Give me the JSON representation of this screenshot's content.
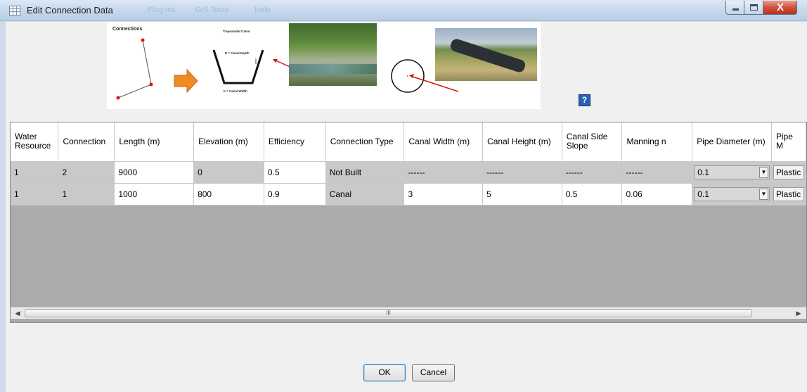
{
  "window": {
    "title": "Edit Connection Data",
    "background_menu": [
      "Plug-ins",
      "GIS Tools",
      "Help"
    ],
    "close_glyph": "X"
  },
  "banner": {
    "connections_label": "Connections",
    "trapezoid_title": "Trapezoidal Canal",
    "depth_label": "D = Canal Depth",
    "width_label": "b = Canal Width",
    "arrow_color": "#f08a24"
  },
  "help_label": "?",
  "grid": {
    "columns": [
      "Water Resource",
      "Connection",
      "Length (m)",
      "Elevation (m)",
      "Efficiency",
      "Connection Type",
      "Canal Width (m)",
      "Canal Height (m)",
      "Canal Side Slope",
      "Manning n",
      "Pipe Diameter (m)",
      "Pipe M"
    ],
    "rows": [
      {
        "water_resource": "1",
        "connection": "2",
        "length": "9000",
        "elevation": "0",
        "efficiency": "0.5",
        "type": "Not Built",
        "canal_width": "------",
        "canal_height": "------",
        "side_slope": "------",
        "manning": "------",
        "pipe_diameter": "0.1",
        "pipe_material": "Plastic"
      },
      {
        "water_resource": "1",
        "connection": "1",
        "length": "1000",
        "elevation": "800",
        "efficiency": "0.9",
        "type": "Canal",
        "canal_width": "3",
        "canal_height": "5",
        "side_slope": "0.5",
        "manning": "0.06",
        "pipe_diameter": "0.1",
        "pipe_material": "Plastic"
      }
    ],
    "scroll_grip": "III"
  },
  "buttons": {
    "ok": "OK",
    "cancel": "Cancel"
  }
}
